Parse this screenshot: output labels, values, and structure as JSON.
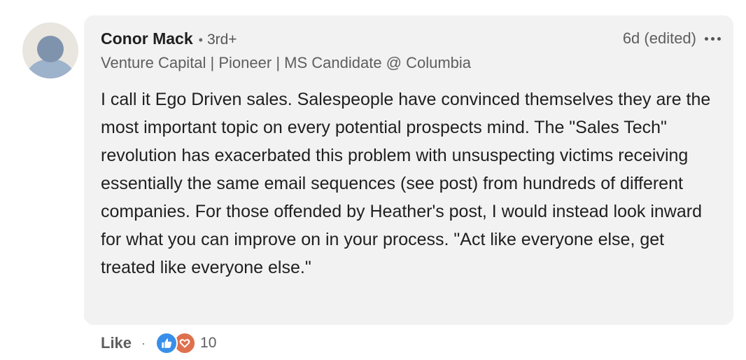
{
  "comment": {
    "author": {
      "name": "Conor Mack",
      "degree": "3rd+",
      "headline": "Venture Capital | Pioneer | MS Candidate @ Columbia"
    },
    "timestamp": "6d (edited)",
    "text": "I call it Ego Driven sales. Salespeople have convinced themselves they are the most important topic on every potential prospects mind. The \"Sales Tech\" revolution has exacerbated this problem with unsuspecting victims receiving essentially the same email sequences (see post) from hundreds of different companies. For those offended by Heather's post, I would instead look inward for what you can improve on in your process. \"Act like everyone else, get treated like everyone else.\"",
    "separator": "•"
  },
  "actions": {
    "like_label": "Like",
    "separator": "·",
    "reaction_count": "10",
    "reaction_icons": [
      "like-icon",
      "love-icon"
    ]
  },
  "colors": {
    "bubble": "#f2f2f2",
    "like_reaction": "#378fe9",
    "love_reaction": "#df704d"
  }
}
